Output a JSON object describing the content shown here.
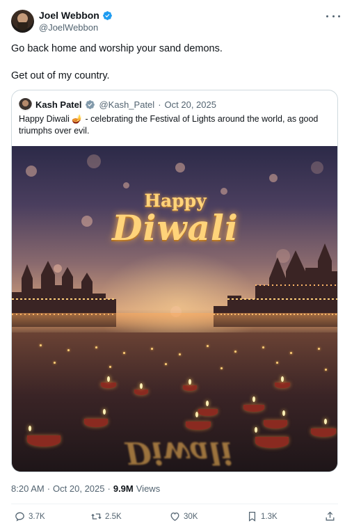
{
  "author": {
    "name": "Joel Webbon",
    "handle": "@JoelWebbon"
  },
  "tweet": {
    "line1": "Go back home and worship your sand demons.",
    "line2": "Get out of my country."
  },
  "quoted": {
    "name": "Kash Patel",
    "handle": "@Kash_Patel",
    "separator": "·",
    "date": "Oct 20, 2025",
    "text": "Happy Diwali 🪔 - celebrating the Festival of Lights around the world, as good triumphs over evil.",
    "image": {
      "happy": "Happy",
      "diwali": "Diwali"
    }
  },
  "meta": {
    "time": "8:20 AM",
    "separator": "·",
    "date": "Oct 20, 2025",
    "separator2": "·",
    "views_count": "9.9M",
    "views_label": "Views"
  },
  "actions": {
    "replies": "3.7K",
    "reposts": "2.5K",
    "likes": "30K",
    "bookmarks": "1.3K"
  },
  "icons": [
    "verified-badge-icon",
    "more-icon",
    "reply-icon",
    "repost-icon",
    "like-icon",
    "bookmark-icon",
    "share-icon"
  ],
  "colors": {
    "verified": "#1d9bf0",
    "secondary_text": "#536471",
    "border": "#cfd9de",
    "primary_text": "#0f1419"
  }
}
